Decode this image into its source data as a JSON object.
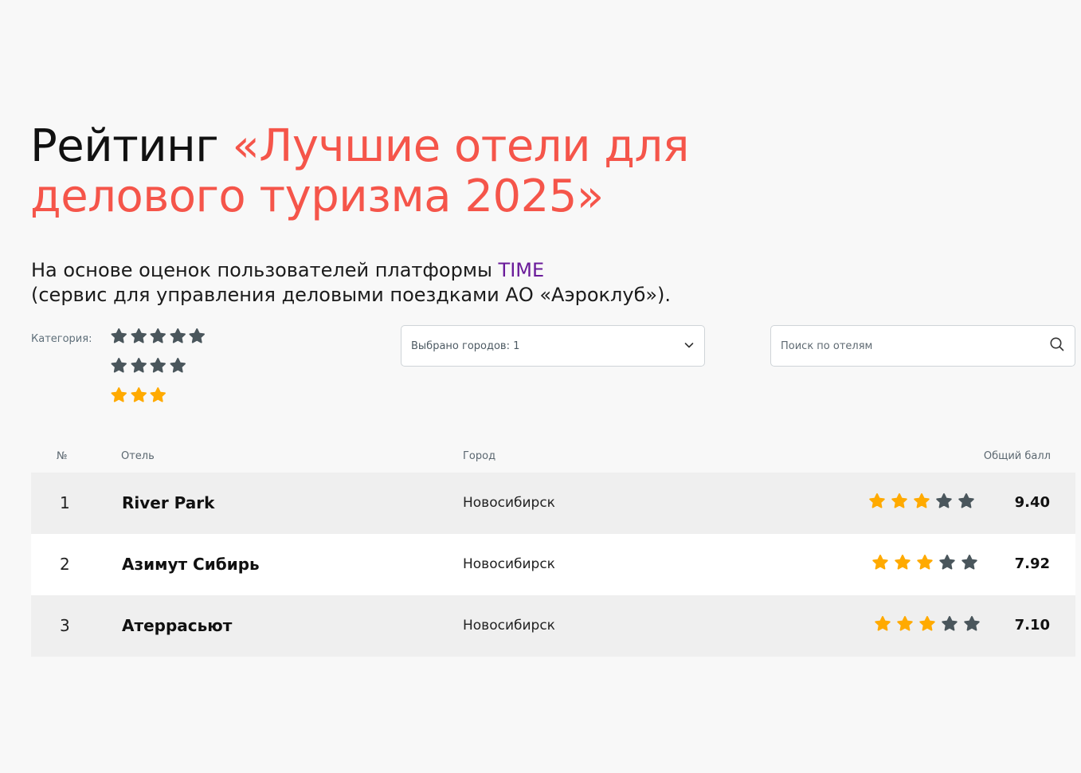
{
  "header": {
    "title_plain": "Рейтинг ",
    "title_accent_line1": "«Лучшие отели для",
    "title_accent_line2": "делового туризма 2025»",
    "subtitle_line1_prefix": "На основе оценок пользователей платформы ",
    "subtitle_brand": "TIME",
    "subtitle_line2": "(сервис для управления деловыми поездками АО «Аэроклуб»)."
  },
  "filters": {
    "category_label": "Категория:",
    "category_options": [
      {
        "stars": 5,
        "selected": false
      },
      {
        "stars": 4,
        "selected": false
      },
      {
        "stars": 3,
        "selected": true
      }
    ],
    "city_select_value": "Выбрано городов: 1",
    "search_placeholder": "Поиск по отелям"
  },
  "table": {
    "headers": {
      "num": "№",
      "hotel": "Отель",
      "city": "Город",
      "score": "Общий балл"
    },
    "rows": [
      {
        "num": "1",
        "name": "River Park",
        "city": "Новосибирск",
        "stars": 3,
        "score": "9.40"
      },
      {
        "num": "2",
        "name": "Азимут Сибирь",
        "city": "Новосибирск",
        "stars": 3,
        "score": "7.92"
      },
      {
        "num": "3",
        "name": "Атеррасьют",
        "city": "Новосибирск",
        "stars": 3,
        "score": "7.10"
      }
    ]
  },
  "colors": {
    "accent": "#f5554a",
    "brand": "#6a1b9a",
    "star_active": "#ffaa00",
    "star_inactive": "#4a565c"
  }
}
